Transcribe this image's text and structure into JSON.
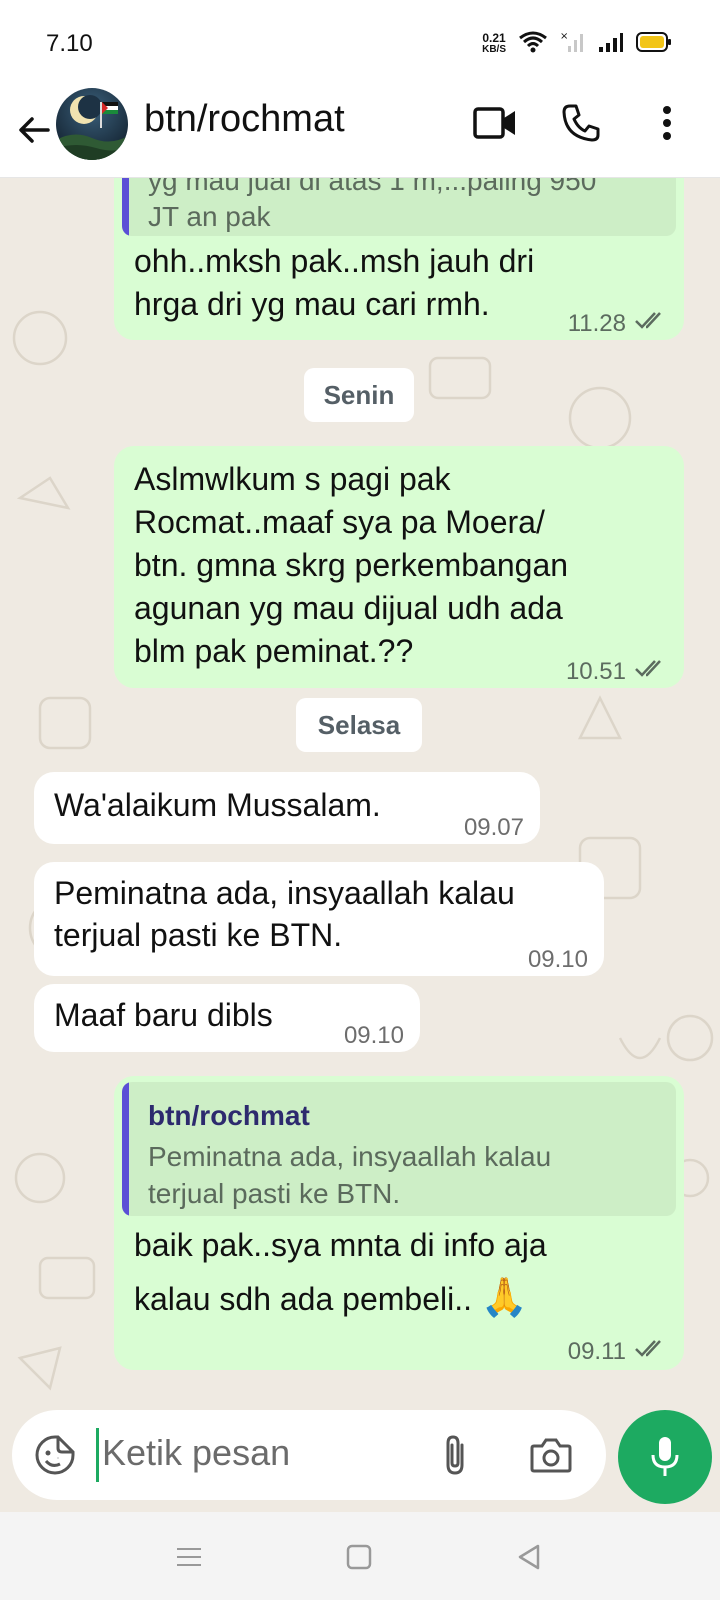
{
  "status_bar": {
    "time": "7.10",
    "net_speed_value": "0.21",
    "net_speed_unit": "KB/S",
    "battery_color": "#f2c518"
  },
  "header": {
    "contact_name": "btn/rochmat"
  },
  "messages": [
    {
      "direction": "out",
      "quote_partial_lines": [
        "yg mau jual di atas 1 m,...paling 950",
        "JT an pak"
      ],
      "text_lines": [
        "ohh..mksh pak..msh jauh dri",
        "hrga dri yg mau cari rmh."
      ],
      "time": "11.28",
      "read": true
    },
    {
      "direction": "out",
      "text_lines": [
        "Aslmwlkum s pagi pak",
        "Rocmat..maaf sya pa Moera/",
        "btn. gmna skrg perkembangan",
        "agunan yg mau dijual udh ada",
        "blm pak peminat.??"
      ],
      "time": "10.51",
      "read": true
    },
    {
      "direction": "in",
      "text_lines": [
        "Wa'alaikum Mussalam."
      ],
      "time": "09.07"
    },
    {
      "direction": "in",
      "text_lines": [
        "Peminatna ada, insyaallah kalau",
        "terjual pasti ke BTN."
      ],
      "time": "09.10"
    },
    {
      "direction": "in",
      "text_lines": [
        "Maaf baru dibls"
      ],
      "time": "09.10"
    },
    {
      "direction": "out",
      "quote_name": "btn/rochmat",
      "quote_lines": [
        "Peminatna ada, insyaallah kalau",
        "terjual pasti ke BTN."
      ],
      "text_lines": [
        "baik pak..sya mnta di info aja",
        "kalau sdh ada pembeli.."
      ],
      "emoji": "🙏",
      "time": "09.11",
      "read": true
    }
  ],
  "day_separators": [
    "Senin",
    "Selasa"
  ],
  "composer": {
    "placeholder": "Ketik pesan"
  },
  "colors": {
    "accent": "#1daa61",
    "outgoing_bubble": "#d9fdd3",
    "incoming_bubble": "#ffffff",
    "chat_background": "#efeae2",
    "read_ticks": "#5c6b5f"
  }
}
